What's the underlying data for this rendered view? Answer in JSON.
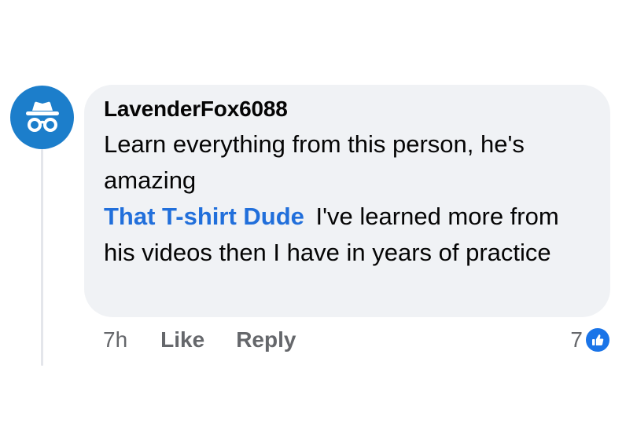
{
  "comment": {
    "author": "LavenderFox6088",
    "text": "Learn everything from this person, he's amazing",
    "reply_mention": "That T-shirt Dude",
    "reply_text": "I've learned more from his videos then I have in years of practice"
  },
  "actions": {
    "time": "7h",
    "like_label": "Like",
    "reply_label": "Reply"
  },
  "reactions": {
    "count": "7",
    "icon": "thumbs-up-icon"
  },
  "colors": {
    "avatar_bg": "#1c7ecb",
    "bubble_bg": "#f0f2f5",
    "mention": "#216fdb",
    "like_badge": "#1a74e8"
  },
  "avatar": {
    "icon": "anonymous-user-icon"
  }
}
